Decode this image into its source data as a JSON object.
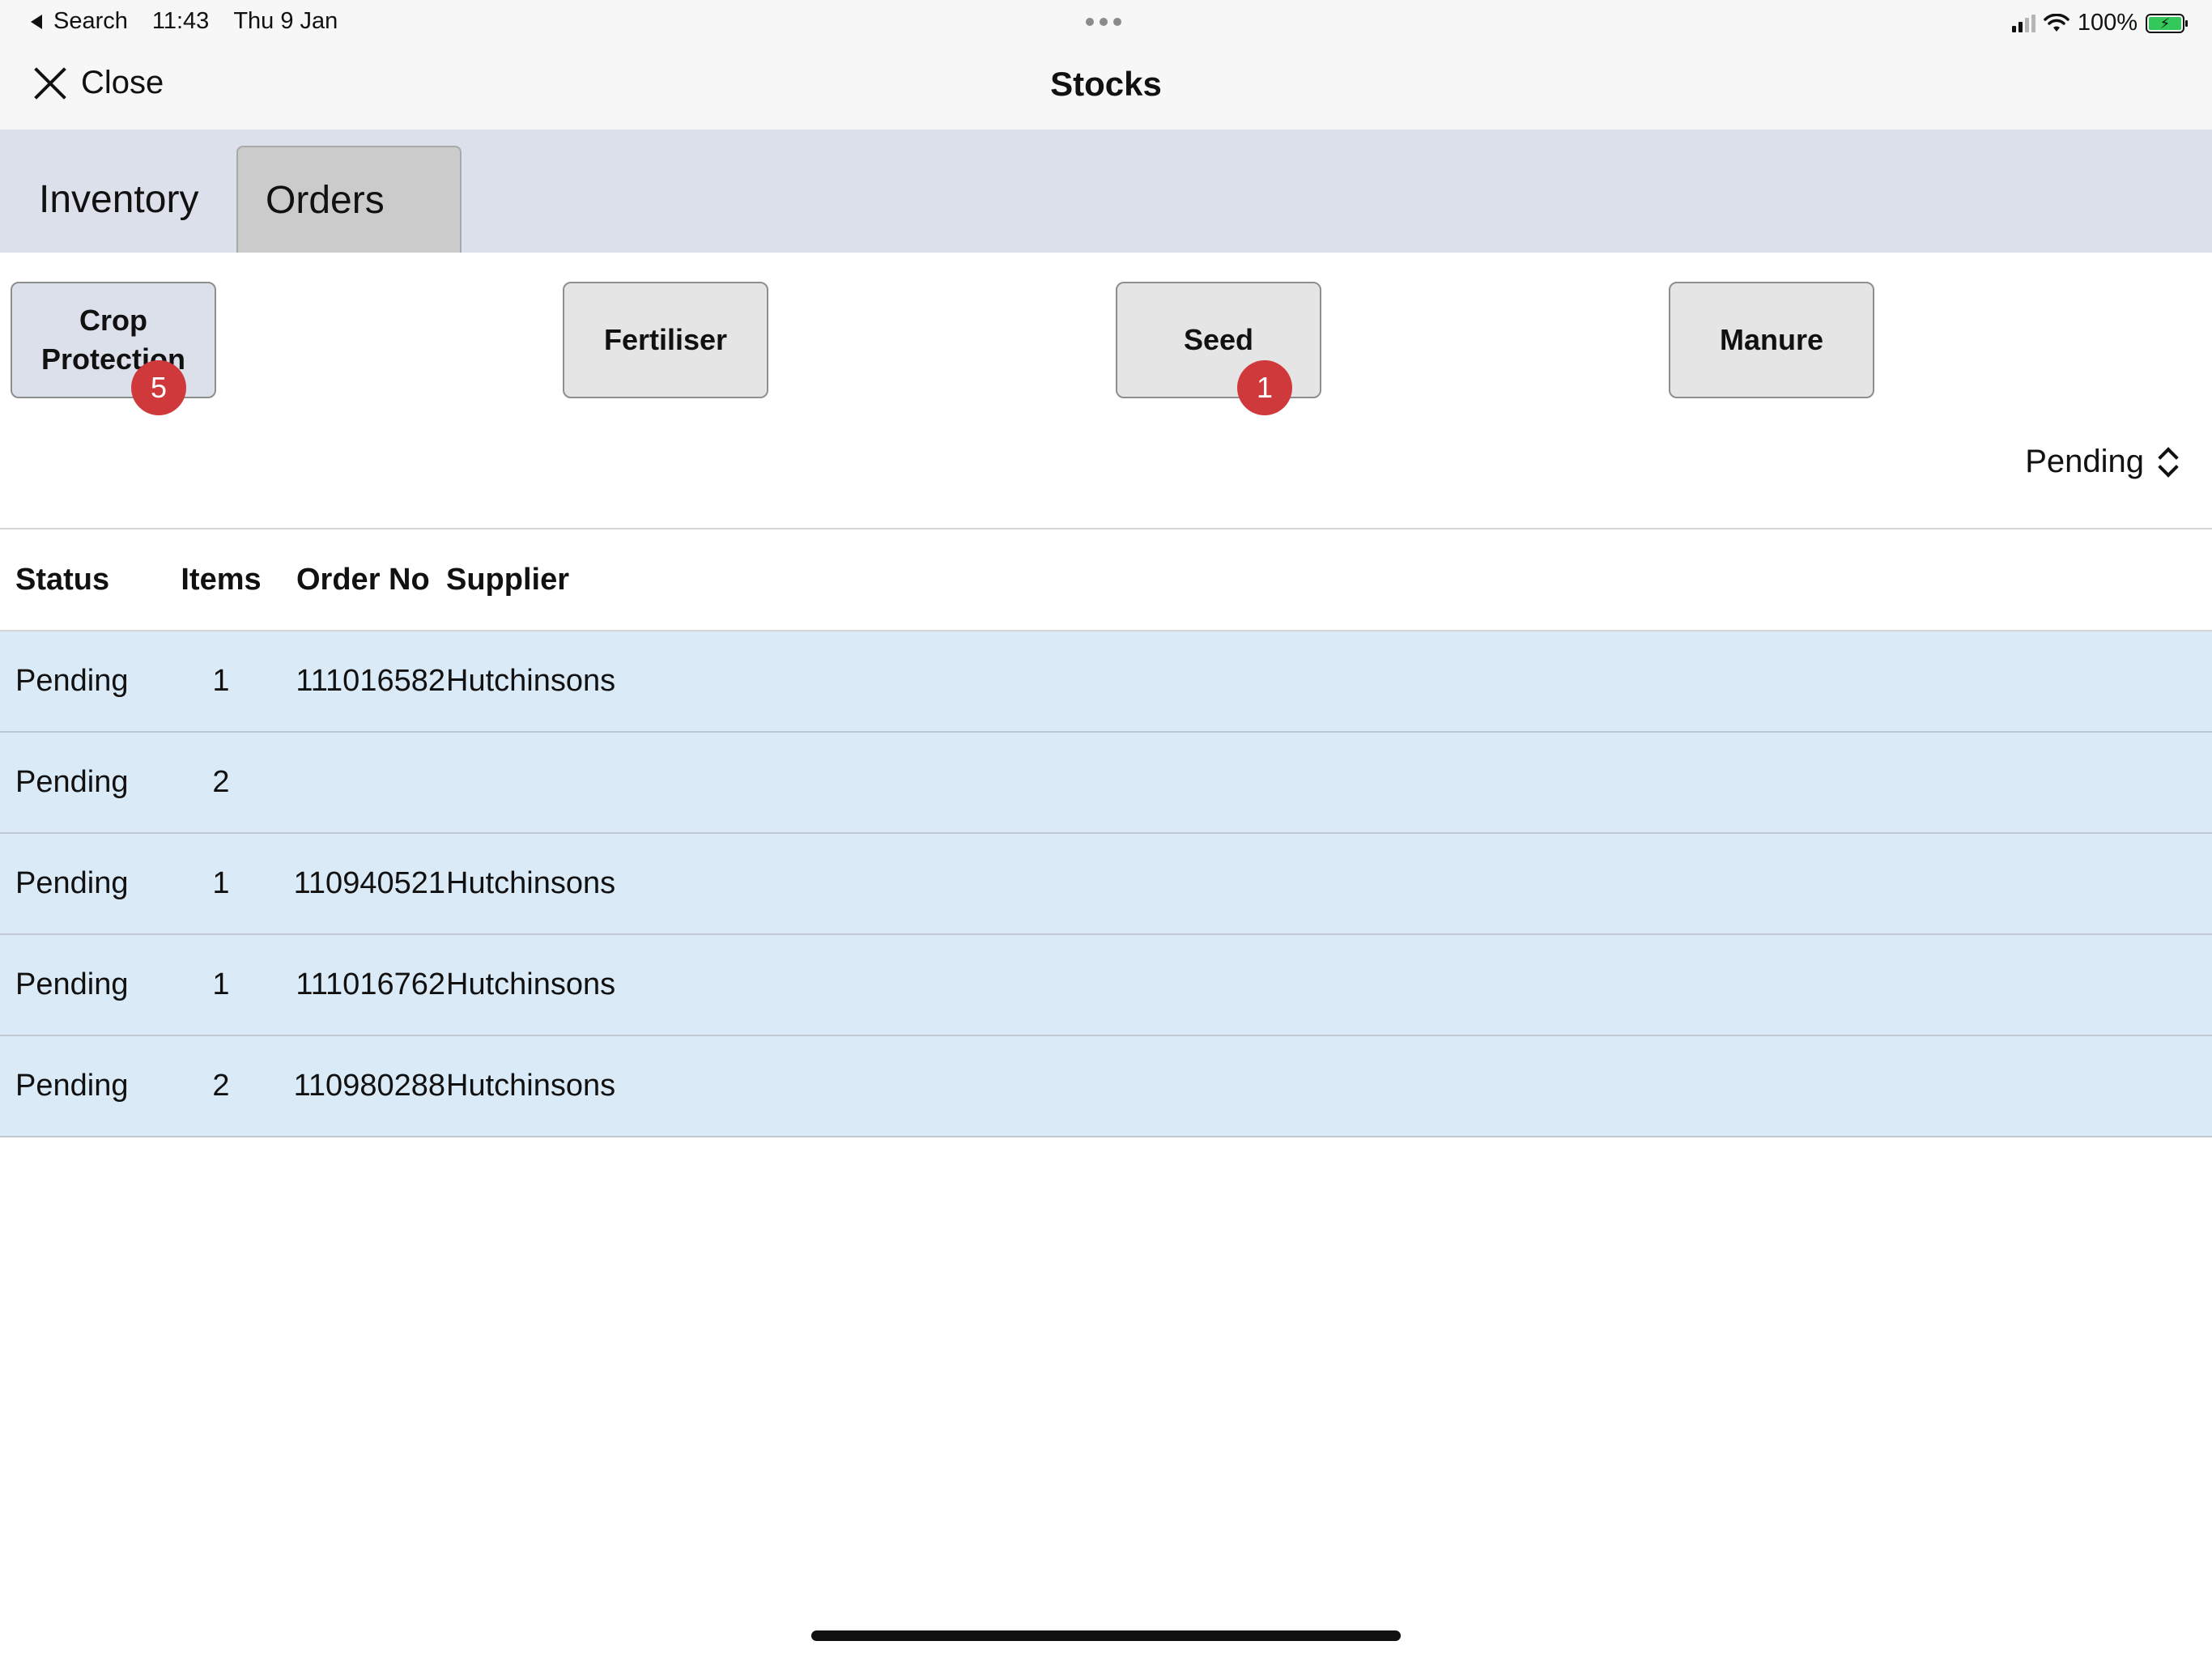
{
  "status_bar": {
    "back_label": "Search",
    "time": "11:43",
    "date": "Thu 9 Jan",
    "battery": "100%"
  },
  "nav": {
    "close_label": "Close",
    "title": "Stocks"
  },
  "tabs": [
    {
      "label": "Inventory"
    },
    {
      "label": "Orders",
      "selected": true
    }
  ],
  "categories": [
    {
      "label_line1": "Crop",
      "label_line2": "Protection",
      "badge": "5"
    },
    {
      "label": "Fertiliser"
    },
    {
      "label": "Seed",
      "badge": "1"
    },
    {
      "label": "Manure"
    }
  ],
  "filter": {
    "value": "Pending"
  },
  "table": {
    "headers": {
      "status": "Status",
      "items": "Items",
      "order_no": "Order No",
      "supplier": "Supplier"
    },
    "rows": [
      {
        "status": "Pending",
        "items": "1",
        "order_no": "111016582",
        "supplier": "Hutchinsons"
      },
      {
        "status": "Pending",
        "items": "2",
        "order_no": "",
        "supplier": ""
      },
      {
        "status": "Pending",
        "items": "1",
        "order_no": "110940521",
        "supplier": "Hutchinsons"
      },
      {
        "status": "Pending",
        "items": "1",
        "order_no": "111016762",
        "supplier": "Hutchinsons"
      },
      {
        "status": "Pending",
        "items": "2",
        "order_no": "110980288",
        "supplier": "Hutchinsons"
      }
    ]
  },
  "colors": {
    "badge": "#d0393b",
    "row_bg": "#dbeaf7",
    "tabbar_bg": "#dbe0eb"
  }
}
